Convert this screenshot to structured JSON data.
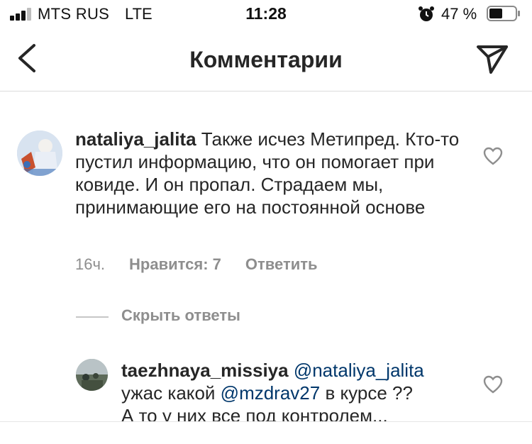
{
  "status_bar": {
    "carrier": "MTS RUS",
    "network": "LTE",
    "time": "11:28",
    "battery_percent": "47 %",
    "battery_level": 0.47,
    "signal_bars": 3
  },
  "header": {
    "title": "Комментарии"
  },
  "comment": {
    "username": "nataliya_jalita",
    "text": "Также исчез Метипред. Кто-то пустил информацию, что он помогает при ковиде. И он пропал. Страдаем мы, принимающие его на постоянной основе",
    "time": "16ч.",
    "likes": "Нравится: 7",
    "reply_label": "Ответить"
  },
  "replies_toggle": {
    "label": "Скрыть ответы"
  },
  "reply": {
    "username": "taezhnaya_missiya",
    "mention1": "@nataliya_jalita",
    "text1": "ужас какой",
    "mention2": "@mzdrav27",
    "text2": " в курсе ??",
    "text3": "А то у них все под контролем..."
  },
  "colors": {
    "text": "#262626",
    "secondary": "#8e8e8e",
    "mention": "#00376b",
    "divider": "#dbdbdb"
  }
}
